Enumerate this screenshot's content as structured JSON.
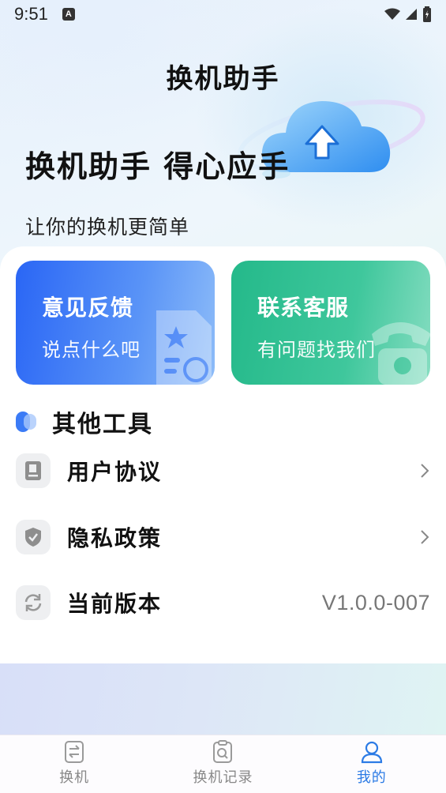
{
  "status_bar": {
    "time": "9:51",
    "notification_badge": "A"
  },
  "header": {
    "app_title": "换机助手"
  },
  "hero": {
    "title": "换机助手 得心应手",
    "subtitle": "让你的换机更简单"
  },
  "cards": {
    "feedback": {
      "title": "意见反馈",
      "subtitle": "说点什么吧"
    },
    "service": {
      "title": "联系客服",
      "subtitle": "有问题找我们"
    }
  },
  "tools": {
    "section_title": "其他工具",
    "items": [
      {
        "label": "用户协议",
        "icon": "document-icon"
      },
      {
        "label": "隐私政策",
        "icon": "shield-check-icon"
      },
      {
        "label": "当前版本",
        "icon": "refresh-icon",
        "value": "V1.0.0-007"
      }
    ]
  },
  "tabs": [
    {
      "label": "换机",
      "icon": "switch-phone-icon",
      "active": false
    },
    {
      "label": "换机记录",
      "icon": "record-search-icon",
      "active": false
    },
    {
      "label": "我的",
      "icon": "user-icon",
      "active": true
    }
  ],
  "colors": {
    "feedback_card": "#2a66f5",
    "service_card": "#24b98a",
    "accent_blue": "#2c7be5",
    "section_dot": "#3b7bf6"
  }
}
